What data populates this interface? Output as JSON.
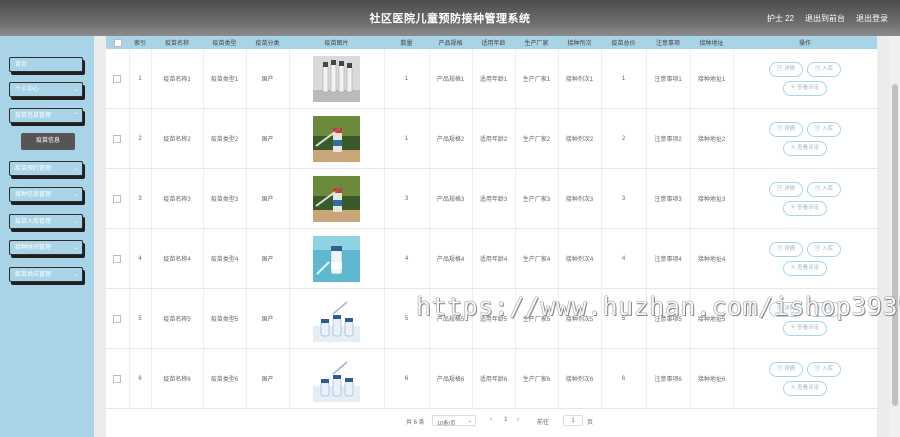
{
  "header": {
    "title": "社区医院儿童预防接种管理系统",
    "user": "护士 22",
    "back_home": "退出到前台",
    "logout": "退出登录"
  },
  "sidebar": {
    "items": [
      {
        "label": "首页",
        "expandable": false
      },
      {
        "label": "个人中心",
        "expandable": true
      },
      {
        "label": "疫苗信息管理",
        "expandable": true
      },
      {
        "label": "疫苗信息",
        "sub": true
      },
      {
        "label": "疫苗预约管理",
        "expandable": true
      },
      {
        "label": "接种信息管理",
        "expandable": true
      },
      {
        "label": "疫苗入库管理",
        "expandable": true
      },
      {
        "label": "接种时间管理",
        "expandable": true
      },
      {
        "label": "疫苗供应管理",
        "expandable": true
      }
    ]
  },
  "table": {
    "columns": [
      "索引",
      "疫苗名称",
      "疫苗类型",
      "疫苗分类",
      "疫苗图片",
      "数量",
      "产品规格",
      "适用年龄",
      "生产厂家",
      "接种剂次",
      "疫苗总价",
      "注意事项",
      "接种地址",
      "操作"
    ],
    "rows": [
      {
        "index": "1",
        "name": "疫苗名称1",
        "type": "疫苗类型1",
        "category": "国产",
        "image": "vials",
        "qty": "1",
        "spec": "产品规格1",
        "age": "适用年龄1",
        "maker": "生产厂家1",
        "dose": "接种剂次1",
        "price": "1",
        "notes": "注意事项1",
        "addr": "接种地址1"
      },
      {
        "index": "2",
        "name": "疫苗名称2",
        "type": "疫苗类型2",
        "category": "国产",
        "image": "syringe-green",
        "qty": "1",
        "spec": "产品规格2",
        "age": "适用年龄2",
        "maker": "生产厂家2",
        "dose": "接种剂次2",
        "price": "2",
        "notes": "注意事项2",
        "addr": "接种地址2"
      },
      {
        "index": "3",
        "name": "疫苗名称3",
        "type": "疫苗类型3",
        "category": "国产",
        "image": "syringe-green",
        "qty": "3",
        "spec": "产品规格3",
        "age": "适用年龄3",
        "maker": "生产厂家3",
        "dose": "接种剂次3",
        "price": "3",
        "notes": "注意事项3",
        "addr": "接种地址3"
      },
      {
        "index": "4",
        "name": "疫苗名称4",
        "type": "疫苗类型4",
        "category": "国产",
        "image": "vial-blue",
        "qty": "4",
        "spec": "产品规格4",
        "age": "适用年龄4",
        "maker": "生产厂家4",
        "dose": "接种剂次4",
        "price": "4",
        "notes": "注意事项4",
        "addr": "接种地址4"
      },
      {
        "index": "5",
        "name": "疫苗名称5",
        "type": "疫苗类型5",
        "category": "国产",
        "image": "vials-white",
        "qty": "5",
        "spec": "产品规格5",
        "age": "适用年龄5",
        "maker": "生产厂家5",
        "dose": "接种剂次5",
        "price": "5",
        "notes": "注意事项5",
        "addr": "接种地址5"
      },
      {
        "index": "6",
        "name": "疫苗名称6",
        "type": "疫苗类型6",
        "category": "国产",
        "image": "vials-white",
        "qty": "6",
        "spec": "产品规格6",
        "age": "适用年龄6",
        "maker": "生产厂家6",
        "dose": "接种剂次6",
        "price": "6",
        "notes": "注意事项6",
        "addr": "接种地址6"
      }
    ],
    "actions": {
      "detail": "详情",
      "stock": "入库",
      "review": "查看评论"
    }
  },
  "pager": {
    "total": "共 6 条",
    "page_size": "10条/页",
    "prev": "‹",
    "current": "1",
    "next": "›",
    "goto": "前往",
    "goto_value": "1",
    "page_suffix": "页"
  },
  "watermark": "https://www.huzhan.com/ishop39397",
  "colors": {
    "accent": "#a9d3e6",
    "sub_active": "#555555",
    "header": "#5a5a5a"
  }
}
